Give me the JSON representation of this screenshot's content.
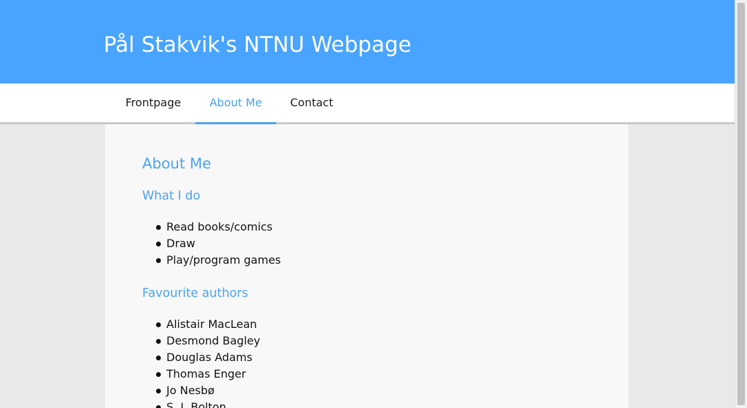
{
  "header": {
    "title": "Pål Stakvik's NTNU Webpage"
  },
  "nav": {
    "items": [
      {
        "label": "Frontpage"
      },
      {
        "label": "About Me"
      },
      {
        "label": "Contact"
      }
    ],
    "active": "About Me"
  },
  "main": {
    "heading": "About Me",
    "sections": [
      {
        "title": "What I do",
        "items": [
          "Read books/comics",
          "Draw",
          "Play/program games"
        ]
      },
      {
        "title": "Favourite authors",
        "items": [
          "Alistair MacLean",
          "Desmond Bagley",
          "Douglas Adams",
          "Thomas Enger",
          "Jo Nesbø",
          "S. J. Bolton"
        ]
      }
    ]
  },
  "colors": {
    "header_bg": "#49a4ff",
    "accent": "#4aa3f2",
    "page_bg": "#e9e9e9",
    "content_bg": "#f8f8f8"
  }
}
